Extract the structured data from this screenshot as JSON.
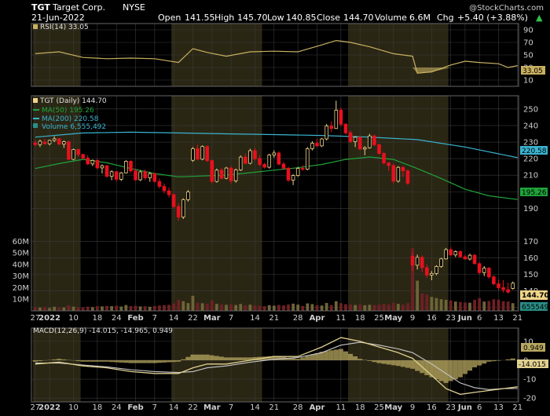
{
  "header": {
    "symbol": "TGT",
    "company": "Target Corp.",
    "exchange": "NYSE",
    "date": "21-Jun-2022",
    "watermark": "@StockCharts.com",
    "open_label": "Open",
    "open": "141.55",
    "high_label": "High",
    "high": "145.70",
    "low_label": "Low",
    "low": "140.85",
    "close_label": "Close",
    "close": "144.70",
    "volume_label": "Volume",
    "volume": "6.6M",
    "chg_label": "Chg",
    "chg": "+5.40 (+3.88%)",
    "up_arrow": "▲"
  },
  "legends": {
    "rsi": "RSI(14) 33.05",
    "price": "TGT (Daily) 144.70",
    "ma50": "MA(50) 195.26",
    "ma200": "MA(200) 220.58",
    "volume": "Volume 6,555,492",
    "macd": "MACD(12,26,9) -14.015, -14.965, 0.949"
  },
  "tags": {
    "rsi": "33.05",
    "ma200": "220.58",
    "ma50": "195.26",
    "close": "144.70",
    "volume": "655549",
    "macd_hist": "0.949",
    "macd": "-14.015"
  },
  "colors": {
    "background": "#000000",
    "shade": "#2a2614",
    "grid": "#3a3a3a",
    "up": "#f0d488",
    "down": "#e8101e",
    "ma50": "#1fa33a",
    "ma200": "#3ab4d0",
    "rsi": "#c8b060",
    "macd": "#e0d090",
    "signal": "#c8c8c8",
    "hist": "#b8a860"
  },
  "chart_data": {
    "type": "candlestick",
    "title": "TGT Target Corp. NYSE",
    "x_tick_labels": [
      "27",
      "2022",
      "10",
      "18",
      "24",
      "Feb",
      "7",
      "14",
      "22",
      "Mar",
      "7",
      "14",
      "21",
      "28",
      "Apr",
      "11",
      "18",
      "25",
      "May",
      "9",
      "16",
      "23",
      "Jun",
      "6",
      "13",
      "21"
    ],
    "price_axis": {
      "ticks": [
        130,
        140,
        150,
        160,
        170,
        190,
        200,
        210,
        220,
        230,
        240,
        250
      ],
      "range": [
        128,
        258
      ]
    },
    "volume_axis": {
      "ticks": [
        "10M",
        "20M",
        "30M",
        "40M",
        "50M",
        "60M"
      ],
      "range": [
        0,
        65000000
      ]
    },
    "rsi_axis": {
      "ticks": [
        10,
        30,
        50,
        70,
        90
      ],
      "range": [
        0,
        100
      ]
    },
    "macd_axis": {
      "ticks": [
        -20,
        -10,
        0,
        10
      ],
      "range": [
        -22,
        17
      ]
    },
    "candles": [
      [
        229.5,
        231.0,
        227.5,
        228.5,
        3.0
      ],
      [
        228.5,
        231.5,
        227.0,
        230.5,
        2.8
      ],
      [
        230.0,
        232.0,
        228.5,
        229.0,
        3.2
      ],
      [
        229.0,
        231.5,
        228.0,
        231.0,
        2.5
      ],
      [
        231.0,
        233.5,
        230.0,
        232.0,
        3.5
      ],
      [
        232.0,
        232.5,
        228.0,
        228.8,
        3.0
      ],
      [
        228.8,
        231.0,
        226.5,
        230.2,
        2.9
      ],
      [
        230.2,
        230.8,
        219.0,
        219.6,
        4.8
      ],
      [
        219.6,
        226.0,
        219.0,
        225.5,
        3.6
      ],
      [
        225.5,
        226.0,
        221.0,
        222.5,
        3.1
      ],
      [
        222.5,
        223.0,
        219.5,
        220.3,
        3.0
      ],
      [
        220.3,
        222.0,
        216.0,
        216.8,
        3.6
      ],
      [
        216.8,
        219.5,
        215.5,
        218.9,
        3.2
      ],
      [
        218.9,
        220.0,
        213.5,
        214.4,
        4.0
      ],
      [
        214.4,
        216.5,
        211.0,
        215.7,
        3.8
      ],
      [
        215.7,
        216.0,
        208.5,
        209.3,
        4.2
      ],
      [
        209.3,
        213.0,
        207.0,
        212.1,
        4.0
      ],
      [
        212.1,
        212.5,
        206.0,
        207.5,
        4.4
      ],
      [
        207.5,
        212.0,
        206.5,
        211.4,
        3.7
      ],
      [
        211.4,
        219.0,
        211.0,
        218.4,
        5.0
      ],
      [
        218.4,
        219.0,
        211.5,
        212.6,
        4.1
      ],
      [
        212.6,
        214.0,
        206.5,
        207.2,
        4.3
      ],
      [
        207.2,
        213.0,
        206.5,
        212.0,
        3.8
      ],
      [
        212.0,
        213.5,
        207.0,
        208.4,
        3.9
      ],
      [
        208.4,
        212.0,
        206.0,
        210.9,
        3.5
      ],
      [
        210.9,
        211.5,
        205.5,
        206.2,
        4.2
      ],
      [
        206.2,
        208.0,
        202.0,
        203.2,
        4.6
      ],
      [
        203.2,
        205.0,
        199.0,
        200.6,
        5.0
      ],
      [
        200.6,
        202.5,
        196.5,
        198.2,
        5.2
      ],
      [
        198.2,
        199.0,
        190.0,
        191.0,
        6.3
      ],
      [
        191.0,
        193.0,
        182.5,
        184.7,
        9.5
      ],
      [
        184.7,
        196.0,
        183.5,
        195.2,
        8.3
      ],
      [
        195.2,
        201.0,
        194.0,
        199.9,
        6.7
      ],
      [
        219.0,
        227.0,
        218.0,
        226.0,
        13.0
      ],
      [
        226.0,
        228.5,
        219.0,
        219.7,
        7.0
      ],
      [
        219.7,
        228.0,
        219.0,
        227.3,
        6.5
      ],
      [
        227.3,
        228.0,
        218.0,
        218.8,
        6.2
      ],
      [
        218.8,
        219.5,
        205.0,
        206.2,
        9.0
      ],
      [
        206.2,
        214.0,
        205.5,
        213.0,
        6.0
      ],
      [
        213.0,
        214.5,
        207.5,
        208.1,
        5.5
      ],
      [
        208.1,
        215.0,
        207.5,
        214.3,
        5.2
      ],
      [
        214.3,
        215.5,
        205.0,
        206.6,
        5.8
      ],
      [
        206.6,
        214.0,
        205.5,
        213.2,
        5.0
      ],
      [
        213.2,
        222.0,
        212.5,
        220.9,
        5.9
      ],
      [
        220.9,
        223.0,
        216.5,
        217.2,
        4.8
      ],
      [
        217.2,
        226.0,
        216.5,
        224.8,
        5.3
      ],
      [
        224.8,
        226.5,
        219.0,
        219.9,
        4.6
      ],
      [
        219.9,
        222.0,
        215.5,
        216.5,
        4.4
      ],
      [
        216.5,
        217.5,
        214.0,
        214.8,
        4.0
      ],
      [
        214.8,
        223.0,
        214.0,
        222.2,
        4.9
      ],
      [
        222.2,
        225.0,
        220.5,
        223.4,
        4.5
      ],
      [
        223.4,
        224.5,
        216.0,
        216.7,
        5.1
      ],
      [
        216.7,
        218.0,
        213.5,
        214.2,
        4.7
      ],
      [
        214.2,
        215.0,
        206.0,
        207.0,
        5.5
      ],
      [
        207.0,
        210.5,
        204.0,
        209.8,
        6.2
      ],
      [
        209.8,
        215.0,
        209.0,
        214.1,
        5.4
      ],
      [
        214.1,
        216.0,
        212.5,
        213.6,
        4.2
      ],
      [
        213.6,
        227.0,
        213.0,
        226.0,
        6.4
      ],
      [
        226.0,
        230.5,
        225.0,
        229.3,
        5.8
      ],
      [
        229.3,
        232.0,
        227.0,
        227.7,
        4.9
      ],
      [
        227.7,
        232.5,
        227.0,
        231.9,
        4.6
      ],
      [
        231.9,
        241.0,
        231.0,
        239.7,
        6.8
      ],
      [
        239.7,
        242.5,
        236.0,
        238.2,
        5.0
      ],
      [
        238.2,
        255.0,
        238.0,
        249.3,
        8.3
      ],
      [
        249.3,
        251.0,
        239.5,
        240.8,
        6.6
      ],
      [
        240.8,
        241.5,
        234.5,
        235.6,
        5.7
      ],
      [
        235.6,
        237.0,
        229.5,
        230.3,
        5.5
      ],
      [
        230.3,
        233.5,
        227.0,
        232.9,
        5.0
      ],
      [
        232.9,
        233.5,
        225.0,
        225.8,
        5.6
      ],
      [
        225.8,
        227.5,
        222.0,
        226.6,
        4.8
      ],
      [
        226.6,
        235.0,
        226.0,
        233.7,
        5.2
      ],
      [
        233.7,
        234.5,
        227.5,
        228.4,
        5.0
      ],
      [
        228.4,
        229.0,
        222.5,
        223.1,
        5.4
      ],
      [
        223.1,
        224.0,
        216.5,
        217.4,
        6.0
      ],
      [
        217.4,
        218.0,
        212.5,
        215.8,
        5.6
      ],
      [
        215.8,
        217.0,
        205.0,
        206.4,
        7.0
      ],
      [
        206.4,
        215.5,
        205.5,
        214.7,
        6.0
      ],
      [
        214.7,
        215.5,
        209.0,
        212.6,
        5.3
      ],
      [
        212.6,
        213.5,
        204.0,
        205.1,
        6.5
      ],
      [
        161.0,
        163.0,
        152.0,
        155.6,
        54.0
      ],
      [
        155.6,
        162.0,
        153.0,
        160.3,
        26.0
      ],
      [
        160.3,
        161.5,
        151.5,
        154.1,
        15.0
      ],
      [
        154.1,
        156.0,
        148.0,
        149.6,
        14.0
      ],
      [
        149.6,
        152.0,
        146.5,
        150.6,
        12.0
      ],
      [
        150.6,
        155.5,
        149.5,
        154.8,
        11.0
      ],
      [
        154.8,
        160.0,
        154.0,
        159.4,
        10.0
      ],
      [
        159.4,
        166.0,
        159.0,
        165.0,
        9.5
      ],
      [
        165.0,
        166.5,
        161.0,
        161.8,
        9.0
      ],
      [
        161.8,
        164.5,
        160.5,
        163.8,
        8.0
      ],
      [
        163.8,
        164.5,
        160.0,
        160.7,
        7.6
      ],
      [
        160.7,
        162.0,
        159.0,
        159.3,
        7.2
      ],
      [
        159.3,
        162.5,
        158.5,
        161.6,
        7.0
      ],
      [
        161.6,
        162.5,
        156.0,
        156.5,
        9.5
      ],
      [
        156.5,
        157.5,
        150.0,
        151.1,
        11.0
      ],
      [
        151.1,
        155.0,
        149.0,
        153.8,
        8.0
      ],
      [
        153.8,
        154.5,
        147.5,
        148.5,
        8.5
      ],
      [
        148.5,
        149.5,
        143.5,
        144.3,
        10.0
      ],
      [
        144.3,
        147.0,
        140.5,
        142.0,
        9.6
      ],
      [
        142.0,
        146.5,
        139.0,
        140.8,
        8.3
      ],
      [
        140.8,
        145.0,
        138.5,
        139.3,
        8.0
      ],
      [
        141.55,
        145.7,
        140.85,
        144.7,
        6.6
      ]
    ],
    "ma50": [
      [
        0,
        214.0
      ],
      [
        5,
        217.0
      ],
      [
        10,
        219.5
      ],
      [
        15,
        217.5
      ],
      [
        20,
        214.0
      ],
      [
        25,
        211.0
      ],
      [
        30,
        209.0
      ],
      [
        35,
        209.5
      ],
      [
        40,
        210.0
      ],
      [
        45,
        211.5
      ],
      [
        50,
        213.0
      ],
      [
        55,
        214.5
      ],
      [
        60,
        216.5
      ],
      [
        65,
        219.5
      ],
      [
        70,
        221.0
      ],
      [
        75,
        219.5
      ],
      [
        80,
        214.0
      ],
      [
        85,
        208.0
      ],
      [
        90,
        201.5
      ],
      [
        95,
        197.5
      ],
      [
        101,
        195.26
      ]
    ],
    "ma200": [
      [
        0,
        233.0
      ],
      [
        10,
        235.5
      ],
      [
        20,
        236.0
      ],
      [
        30,
        235.5
      ],
      [
        40,
        235.0
      ],
      [
        50,
        234.5
      ],
      [
        60,
        234.0
      ],
      [
        70,
        233.0
      ],
      [
        80,
        231.5
      ],
      [
        90,
        227.0
      ],
      [
        101,
        220.58
      ]
    ],
    "rsi": [
      [
        0,
        52
      ],
      [
        5,
        55
      ],
      [
        10,
        46
      ],
      [
        15,
        44
      ],
      [
        20,
        45
      ],
      [
        25,
        44
      ],
      [
        30,
        38
      ],
      [
        33,
        60
      ],
      [
        36,
        54
      ],
      [
        40,
        48
      ],
      [
        45,
        55
      ],
      [
        50,
        56
      ],
      [
        55,
        55
      ],
      [
        60,
        66
      ],
      [
        63,
        73
      ],
      [
        66,
        70
      ],
      [
        70,
        63
      ],
      [
        75,
        52
      ],
      [
        79,
        48
      ],
      [
        80,
        21
      ],
      [
        83,
        23
      ],
      [
        87,
        34
      ],
      [
        90,
        40
      ],
      [
        93,
        38
      ],
      [
        97,
        36
      ],
      [
        99,
        30
      ],
      [
        101,
        33.05
      ]
    ],
    "macd": [
      [
        0,
        -2
      ],
      [
        5,
        -1
      ],
      [
        10,
        -3
      ],
      [
        15,
        -4
      ],
      [
        20,
        -6
      ],
      [
        25,
        -7
      ],
      [
        30,
        -7
      ],
      [
        33,
        -4
      ],
      [
        36,
        -2
      ],
      [
        40,
        -2
      ],
      [
        45,
        0
      ],
      [
        50,
        2
      ],
      [
        55,
        2
      ],
      [
        60,
        7
      ],
      [
        64,
        12
      ],
      [
        68,
        10
      ],
      [
        72,
        7
      ],
      [
        76,
        4
      ],
      [
        79,
        1
      ],
      [
        83,
        -8
      ],
      [
        86,
        -15
      ],
      [
        89,
        -18
      ],
      [
        92,
        -17
      ],
      [
        95,
        -16
      ],
      [
        98,
        -15
      ],
      [
        101,
        -14.015
      ]
    ],
    "signal": [
      [
        0,
        -1.5
      ],
      [
        5,
        -1.5
      ],
      [
        10,
        -2.5
      ],
      [
        15,
        -3.5
      ],
      [
        20,
        -5
      ],
      [
        25,
        -6
      ],
      [
        30,
        -6.5
      ],
      [
        33,
        -6
      ],
      [
        36,
        -4
      ],
      [
        40,
        -3
      ],
      [
        45,
        -1
      ],
      [
        50,
        0.5
      ],
      [
        55,
        1.5
      ],
      [
        60,
        4
      ],
      [
        64,
        8
      ],
      [
        68,
        9.5
      ],
      [
        72,
        8
      ],
      [
        76,
        6
      ],
      [
        79,
        4
      ],
      [
        83,
        -2
      ],
      [
        86,
        -7
      ],
      [
        89,
        -12
      ],
      [
        92,
        -14.5
      ],
      [
        95,
        -15.5
      ],
      [
        98,
        -15
      ],
      [
        101,
        -14.965
      ]
    ]
  }
}
